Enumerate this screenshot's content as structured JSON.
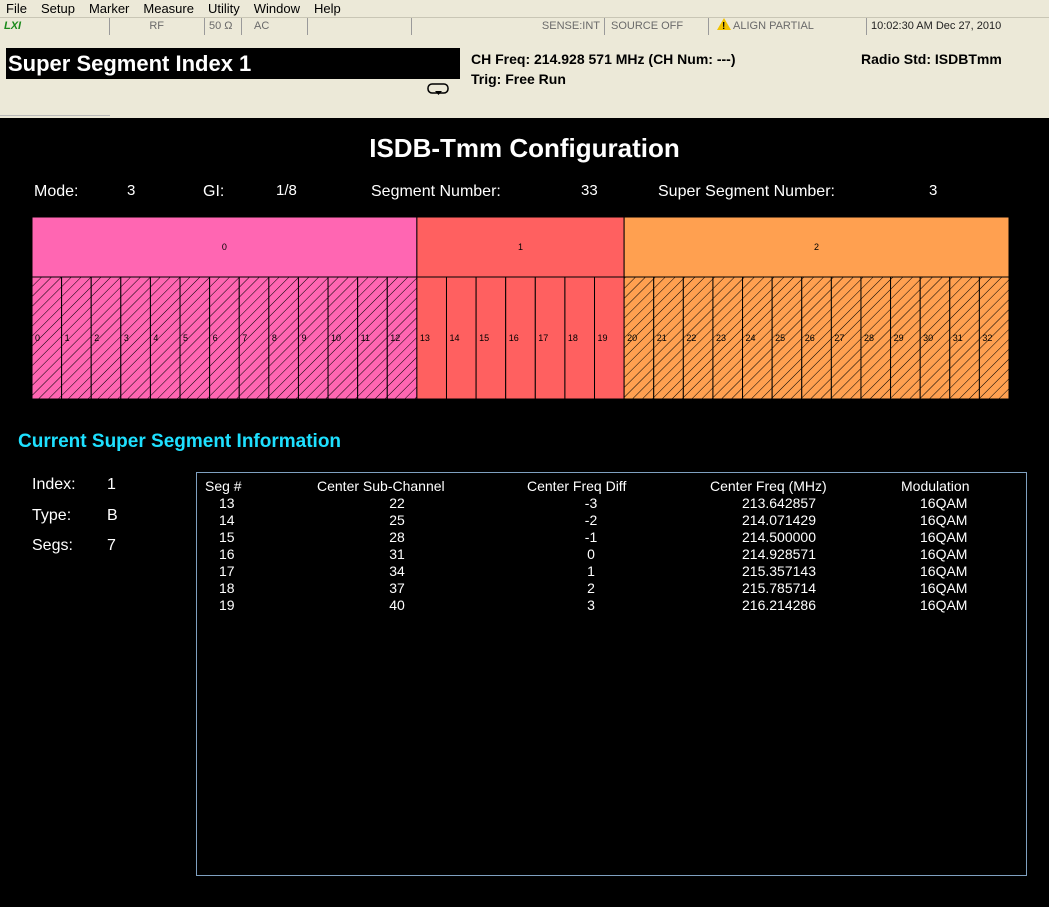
{
  "menu": [
    "File",
    "Setup",
    "Marker",
    "Measure",
    "Utility",
    "Window",
    "Help"
  ],
  "status": {
    "lxi": "LXI",
    "rf": "RF",
    "impedance": "50 Ω",
    "coupling": "AC",
    "sense": "SENSE:INT",
    "source": "SOURCE OFF",
    "align": "ALIGN PARTIAL",
    "datetime": "10:02:30 AM Dec 27, 2010"
  },
  "header": {
    "title": "Super Segment Index  1",
    "ch_freq": "CH Freq: 214.928 571 MHz (CH Num: ---)",
    "trig": "Trig: Free Run",
    "radio_std": "Radio Std: ISDBTmm"
  },
  "config": {
    "title": "ISDB-Tmm Configuration",
    "mode_label": "Mode:",
    "mode_value": "3",
    "gi_label": "GI:",
    "gi_value": "1/8",
    "segnum_label": "Segment Number:",
    "segnum_value": "33",
    "supersegnum_label": "Super Segment Number:",
    "supersegnum_value": "3"
  },
  "segment_map": {
    "super_segments": [
      {
        "label": "0",
        "first": 0,
        "last": 12,
        "color": "#ff66b2",
        "hatched": true
      },
      {
        "label": "1",
        "first": 13,
        "last": 19,
        "color": "#ff6060",
        "hatched": false
      },
      {
        "label": "2",
        "first": 20,
        "last": 32,
        "color": "#ffa050",
        "hatched": true
      }
    ]
  },
  "info": {
    "title": "Current Super Segment Information",
    "index_label": "Index:",
    "index_value": "1",
    "type_label": "Type:",
    "type_value": "B",
    "segs_label": "Segs:",
    "segs_value": "7"
  },
  "table": {
    "headers": [
      "Seg #",
      "Center Sub-Channel",
      "Center Freq Diff",
      "Center Freq (MHz)",
      "Modulation"
    ],
    "rows": [
      [
        "13",
        "22",
        "-3",
        "213.642857",
        "16QAM"
      ],
      [
        "14",
        "25",
        "-2",
        "214.071429",
        "16QAM"
      ],
      [
        "15",
        "28",
        "-1",
        "214.500000",
        "16QAM"
      ],
      [
        "16",
        "31",
        "0",
        "214.928571",
        "16QAM"
      ],
      [
        "17",
        "34",
        "1",
        "215.357143",
        "16QAM"
      ],
      [
        "18",
        "37",
        "2",
        "215.785714",
        "16QAM"
      ],
      [
        "19",
        "40",
        "3",
        "216.214286",
        "16QAM"
      ]
    ]
  }
}
